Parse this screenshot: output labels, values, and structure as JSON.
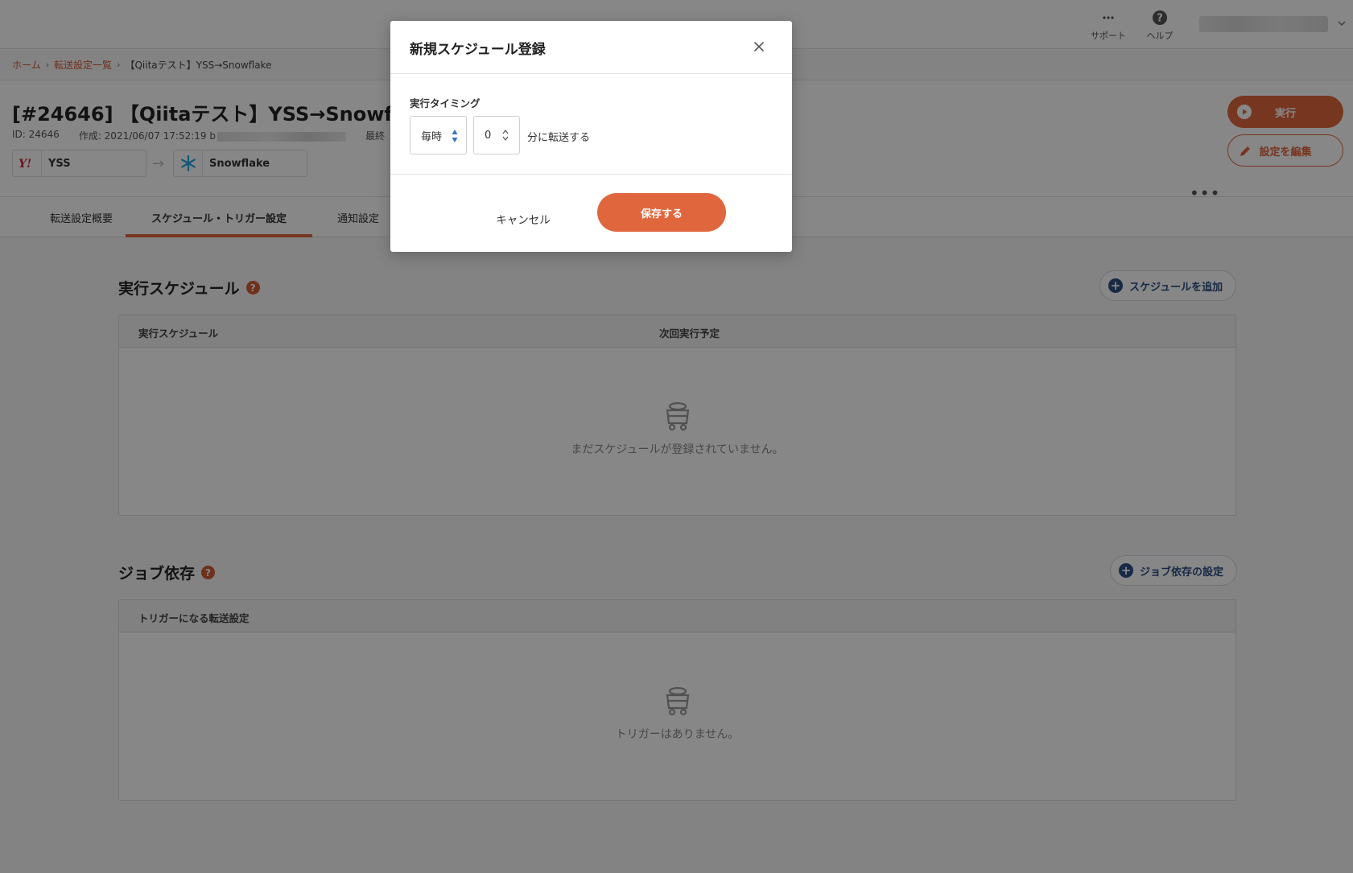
{
  "topbar": {
    "support_label": "サポート",
    "help_label": "ヘルプ"
  },
  "breadcrumb": {
    "home": "ホーム",
    "list": "転送設定一覧",
    "current": "【Qiitaテスト】YSS→Snowflake"
  },
  "header": {
    "title": "[#24646] 【Qiitaテスト】YSS→Snowflake",
    "id_text": "ID: 24646",
    "created_text": "作成: 2021/06/07 17:52:19 b",
    "updated_prefix": "最終",
    "source_name": "YSS",
    "destination_name": "Snowflake",
    "run_label": "実行",
    "edit_label": "設定を編集",
    "more_label": "•••"
  },
  "tabs": {
    "overview": "転送設定概要",
    "schedule": "スケジュール・トリガー設定",
    "notify": "通知設定"
  },
  "schedule_section": {
    "title": "実行スケジュール",
    "add_button": "スケジュールを追加",
    "col_schedule": "実行スケジュール",
    "col_next": "次回実行予定",
    "empty_text": "まだスケジュールが登録されていません。"
  },
  "dependency_section": {
    "title": "ジョブ依存",
    "settings_button": "ジョブ依存の設定",
    "col_trigger": "トリガーになる転送設定",
    "empty_text": "トリガーはありません。"
  },
  "modal": {
    "title": "新規スケジュール登録",
    "field_label": "実行タイミング",
    "frequency_value": "毎時",
    "minute_value": "0",
    "suffix_text": "分に転送する",
    "cancel_label": "キャンセル",
    "save_label": "保存する"
  },
  "colors": {
    "accent": "#e0673d",
    "link": "#d35c36",
    "navy": "#2d4f83"
  }
}
